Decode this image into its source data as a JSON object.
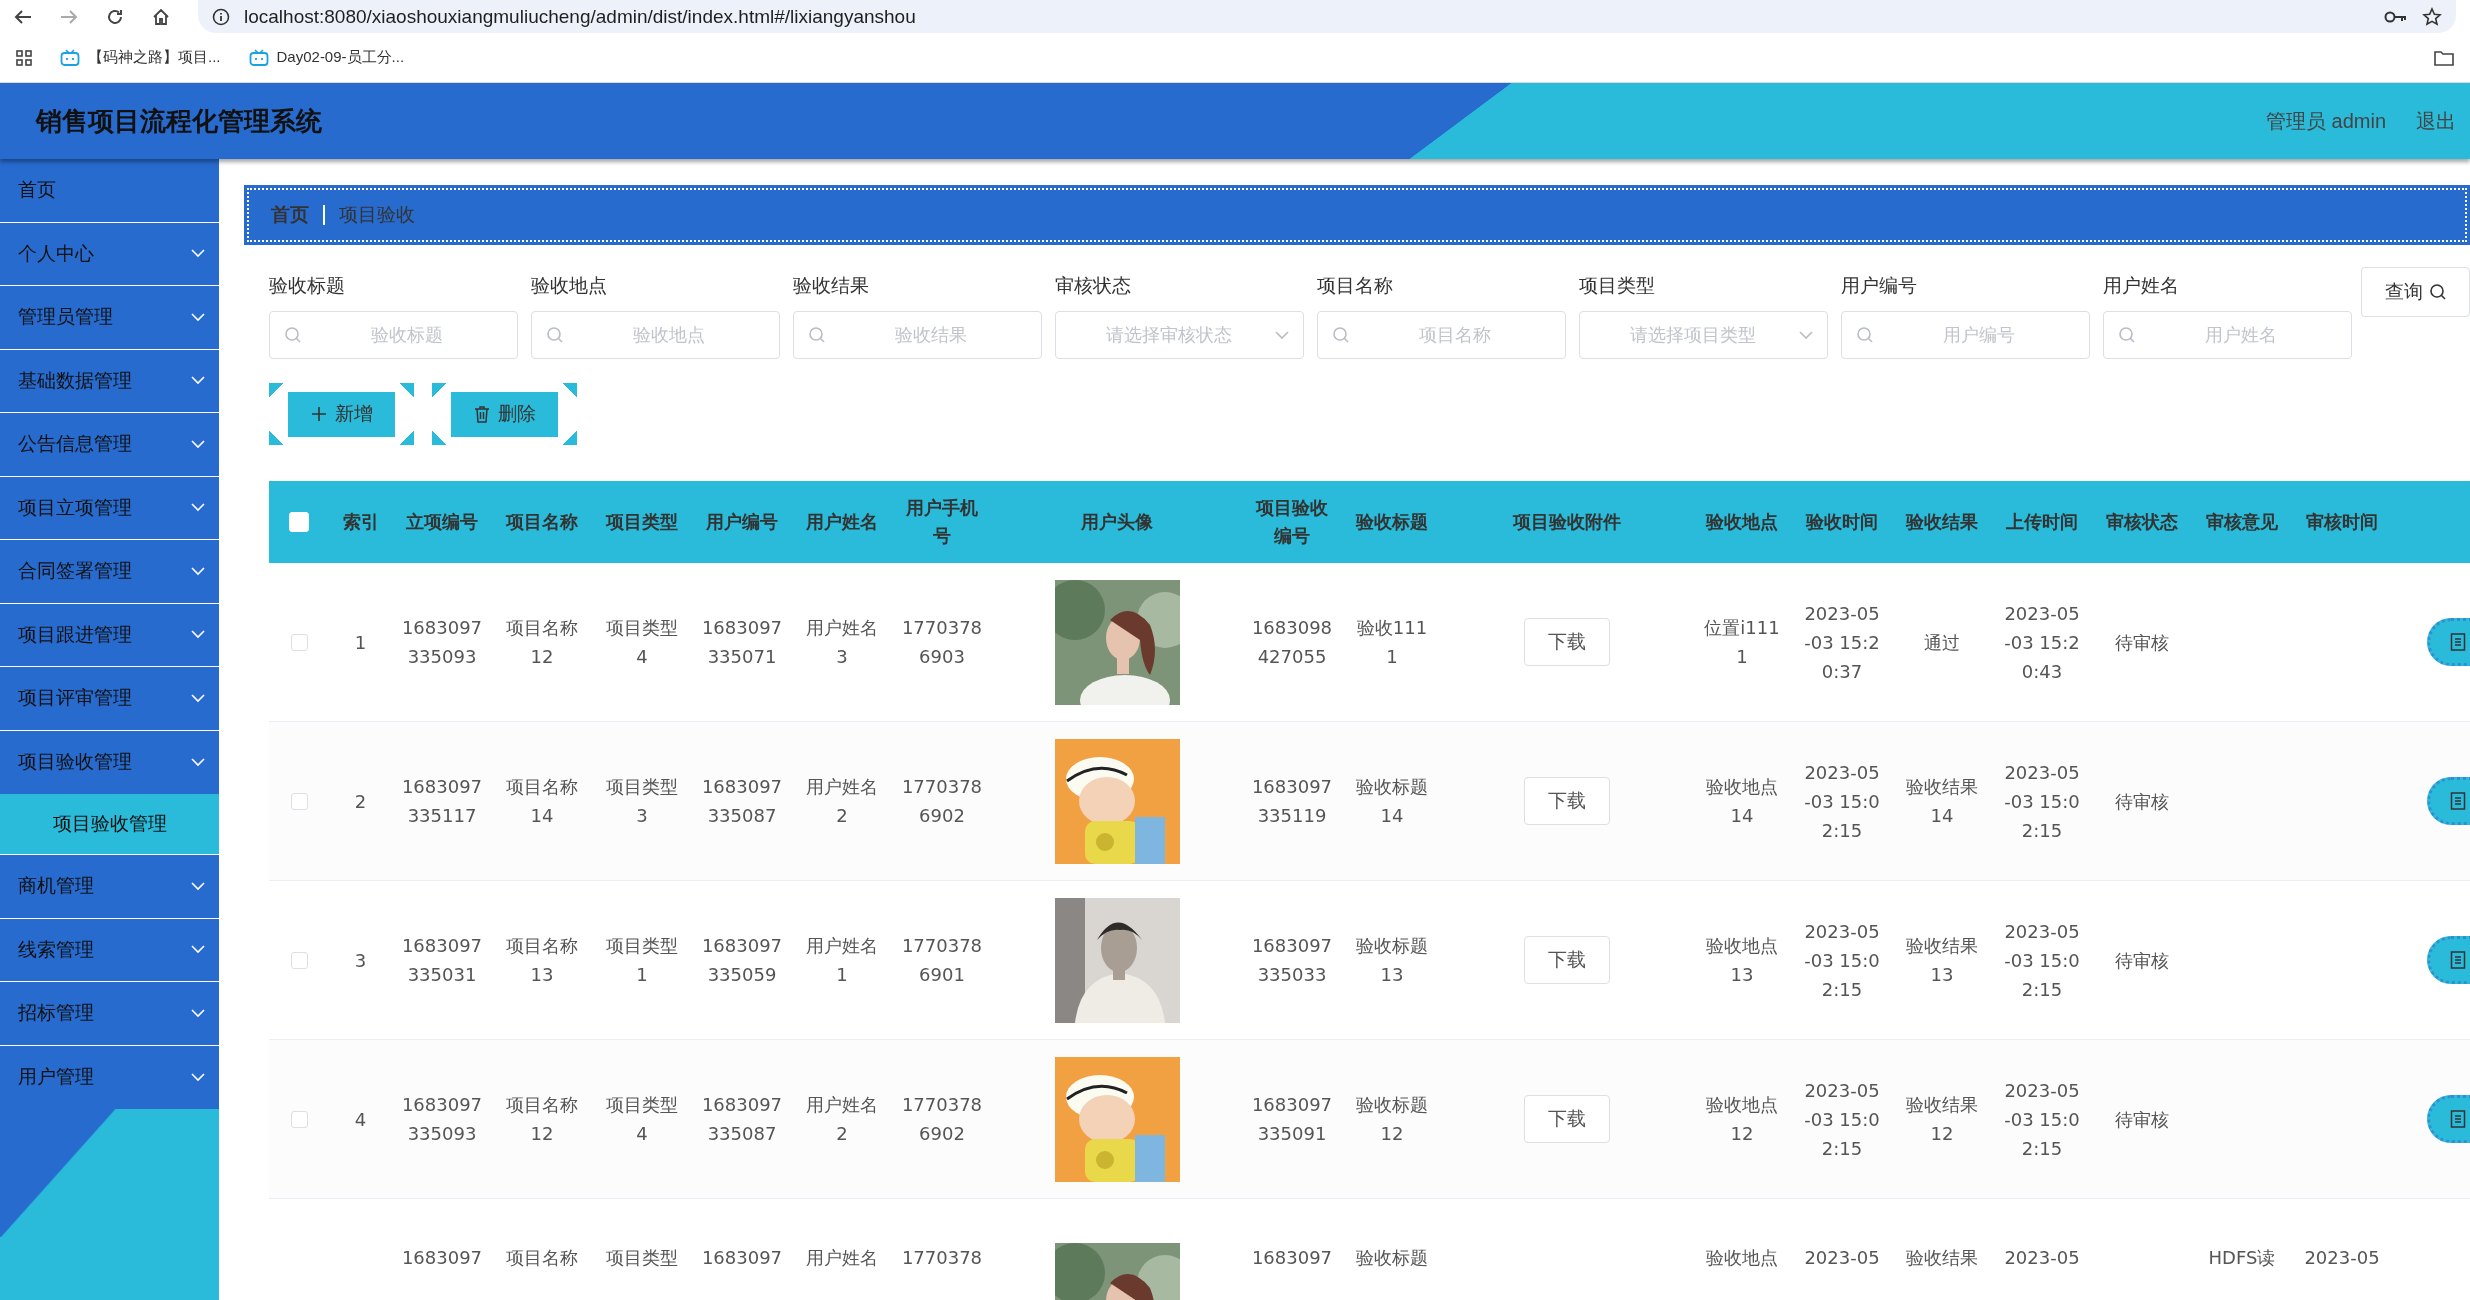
{
  "browser": {
    "url": "localhost:8080/xiaoshouxiangmuliucheng/admin/dist/index.html#/lixiangyanshou",
    "bookmarks": [
      "【码神之路】项目...",
      "Day02-09-员工分..."
    ]
  },
  "header": {
    "title": "销售项目流程化管理系统",
    "user": "管理员 admin",
    "logout": "退出"
  },
  "sidebar": {
    "items": [
      {
        "label": "首页",
        "kind": "link"
      },
      {
        "label": "个人中心",
        "kind": "menu",
        "expanded": false
      },
      {
        "label": "管理员管理",
        "kind": "menu",
        "expanded": false
      },
      {
        "label": "基础数据管理",
        "kind": "menu",
        "expanded": false
      },
      {
        "label": "公告信息管理",
        "kind": "menu",
        "expanded": false
      },
      {
        "label": "项目立项管理",
        "kind": "menu",
        "expanded": false
      },
      {
        "label": "合同签署管理",
        "kind": "menu",
        "expanded": false
      },
      {
        "label": "项目跟进管理",
        "kind": "menu",
        "expanded": false
      },
      {
        "label": "项目评审管理",
        "kind": "menu",
        "expanded": false
      },
      {
        "label": "项目验收管理",
        "kind": "menu",
        "expanded": true,
        "children": [
          {
            "label": "项目验收管理",
            "selected": true
          }
        ]
      },
      {
        "label": "商机管理",
        "kind": "menu",
        "expanded": false
      },
      {
        "label": "线索管理",
        "kind": "menu",
        "expanded": false
      },
      {
        "label": "招标管理",
        "kind": "menu",
        "expanded": false
      },
      {
        "label": "用户管理",
        "kind": "menu",
        "expanded": false
      }
    ]
  },
  "breadcrumb": [
    "首页",
    "项目验收"
  ],
  "filters": [
    {
      "label": "验收标题",
      "kind": "search",
      "placeholder": "验收标题"
    },
    {
      "label": "验收地点",
      "kind": "search",
      "placeholder": "验收地点"
    },
    {
      "label": "验收结果",
      "kind": "search",
      "placeholder": "验收结果"
    },
    {
      "label": "审核状态",
      "kind": "select",
      "placeholder": "请选择审核状态"
    },
    {
      "label": "项目名称",
      "kind": "search",
      "placeholder": "项目名称"
    },
    {
      "label": "项目类型",
      "kind": "select",
      "placeholder": "请选择项目类型"
    },
    {
      "label": "用户编号",
      "kind": "search",
      "placeholder": "用户编号"
    },
    {
      "label": "用户姓名",
      "kind": "search",
      "placeholder": "用户姓名"
    }
  ],
  "query_button": "查询",
  "actions": [
    {
      "label": "新增",
      "kind": "add"
    },
    {
      "label": "删除",
      "kind": "delete"
    }
  ],
  "table": {
    "all_selected": false,
    "columns": [
      "索引",
      "立项编号",
      "项目名称",
      "项目类型",
      "用户编号",
      "用户姓名",
      "用户手机号",
      "用户头像",
      "项目验收编号",
      "验收标题",
      "项目验收附件",
      "验收地点",
      "验收时间",
      "验收结果",
      "上传时间",
      "审核状态",
      "审核意见",
      "审核时间"
    ],
    "rows": [
      {
        "selected": false,
        "index": "1",
        "project_no": "1683097335093",
        "project_name": "项目名称12",
        "project_type": "项目类型4",
        "user_no": "1683097335071",
        "user_name": "用户姓名3",
        "phone": "17703786903",
        "acceptance_no": "1683098427055",
        "title": "验收1111",
        "attachment": "下载",
        "location": "位置i1111",
        "time": "2023-05-03 15:20:37",
        "result": "通过",
        "upload_time": "2023-05-03 15:20:43",
        "status": "待审核",
        "action": true
      },
      {
        "selected": false,
        "index": "2",
        "project_no": "1683097335117",
        "project_name": "项目名称14",
        "project_type": "项目类型3",
        "user_no": "1683097335087",
        "user_name": "用户姓名2",
        "phone": "17703786902",
        "acceptance_no": "1683097335119",
        "title": "验收标题14",
        "attachment": "下载",
        "location": "验收地点14",
        "time": "2023-05-03 15:02:15",
        "result": "验收结果14",
        "upload_time": "2023-05-03 15:02:15",
        "status": "待审核",
        "action": true
      },
      {
        "selected": false,
        "index": "3",
        "project_no": "1683097335031",
        "project_name": "项目名称13",
        "project_type": "项目类型1",
        "user_no": "1683097335059",
        "user_name": "用户姓名1",
        "phone": "17703786901",
        "acceptance_no": "1683097335033",
        "title": "验收标题13",
        "attachment": "下载",
        "location": "验收地点13",
        "time": "2023-05-03 15:02:15",
        "result": "验收结果13",
        "upload_time": "2023-05-03 15:02:15",
        "status": "待审核",
        "action": true
      },
      {
        "selected": false,
        "index": "4",
        "project_no": "1683097335093",
        "project_name": "项目名称12",
        "project_type": "项目类型4",
        "user_no": "1683097335087",
        "user_name": "用户姓名2",
        "phone": "17703786902",
        "acceptance_no": "1683097335091",
        "title": "验收标题12",
        "attachment": "下载",
        "location": "验收地点12",
        "time": "2023-05-03 15:02:15",
        "result": "验收结果12",
        "upload_time": "2023-05-03 15:02:15",
        "status": "待审核",
        "action": true
      },
      {
        "project_no": "1683097",
        "project_name": "项目名称",
        "project_type": "项目类型",
        "user_no": "1683097",
        "user_name": "用户姓名",
        "phone": "1770378",
        "acceptance_no": "1683097",
        "title": "验收标题",
        "location": "验收地点",
        "time": "2023-05",
        "result": "验收结果",
        "upload_time": "2023-05",
        "review_opinion": "HDFS读",
        "review_time": "2023-05"
      }
    ]
  }
}
